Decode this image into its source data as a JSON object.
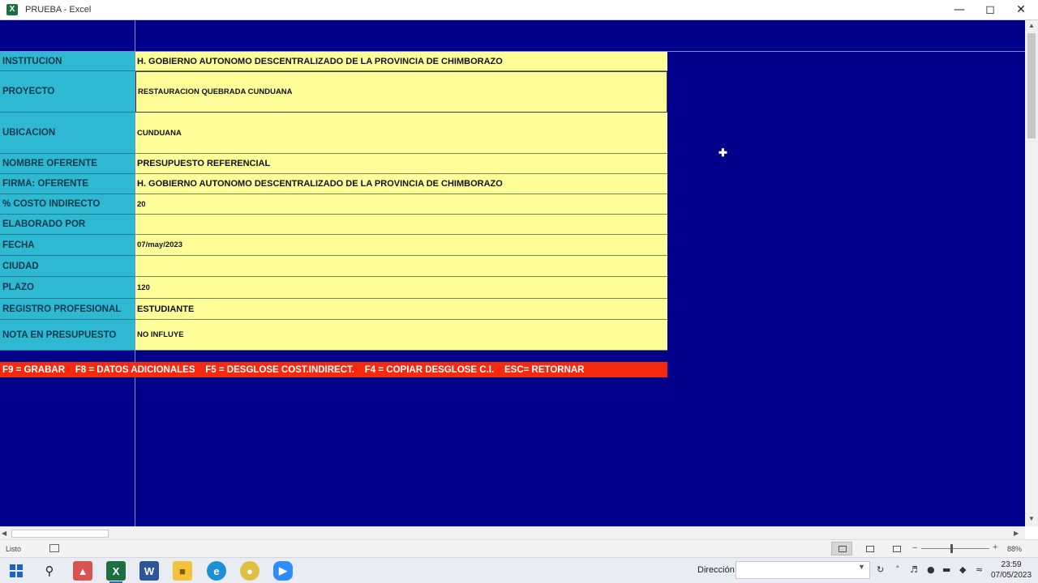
{
  "window": {
    "title": "PRUEBA - Excel",
    "app_icon": "X"
  },
  "form": {
    "rows": [
      {
        "label": "INSTITUCION",
        "value": "H. GOBIERNO AUTONOMO DESCENTRALIZADO DE LA PROVINCIA DE CHIMBORAZO"
      },
      {
        "label": "PROYECTO",
        "value": "RESTAURACION QUEBRADA CUNDUANA"
      },
      {
        "label": "UBICACION",
        "value": "CUNDUANA"
      },
      {
        "label": "NOMBRE OFERENTE",
        "value": "PRESUPUESTO REFERENCIAL"
      },
      {
        "label": "FIRMA: OFERENTE",
        "value": "H. GOBIERNO AUTONOMO DESCENTRALIZADO DE LA PROVINCIA DE CHIMBORAZO"
      },
      {
        "label": "% COSTO INDIRECTO",
        "value": "20"
      },
      {
        "label": "ELABORADO POR",
        "value": ""
      },
      {
        "label": "FECHA",
        "value": "07/may/2023"
      },
      {
        "label": "CIUDAD",
        "value": ""
      },
      {
        "label": "PLAZO",
        "value": "120"
      },
      {
        "label": "REGISTRO PROFESIONAL",
        "value": "ESTUDIANTE"
      },
      {
        "label": "NOTA EN PRESUPUESTO",
        "value": "NO INFLUYE"
      }
    ]
  },
  "function_keys": "F9 = GRABAR    F8 = DATOS ADICIONALES    F5 = DESGLOSE COST.INDIRECT.    F4 = COPIAR DESGLOSE C.I.    ESC= RETORNAR",
  "statusbar": {
    "ready": "Listo",
    "zoom": "88%"
  },
  "taskbar": {
    "address_label": "Dirección",
    "time": "23:59",
    "date": "07/05/2023"
  },
  "colors": {
    "sheet_bg": "#00008b",
    "label_bg": "#2fb8d2",
    "value_bg": "#ffff99",
    "fkeys_bg": "#f42a0e"
  }
}
